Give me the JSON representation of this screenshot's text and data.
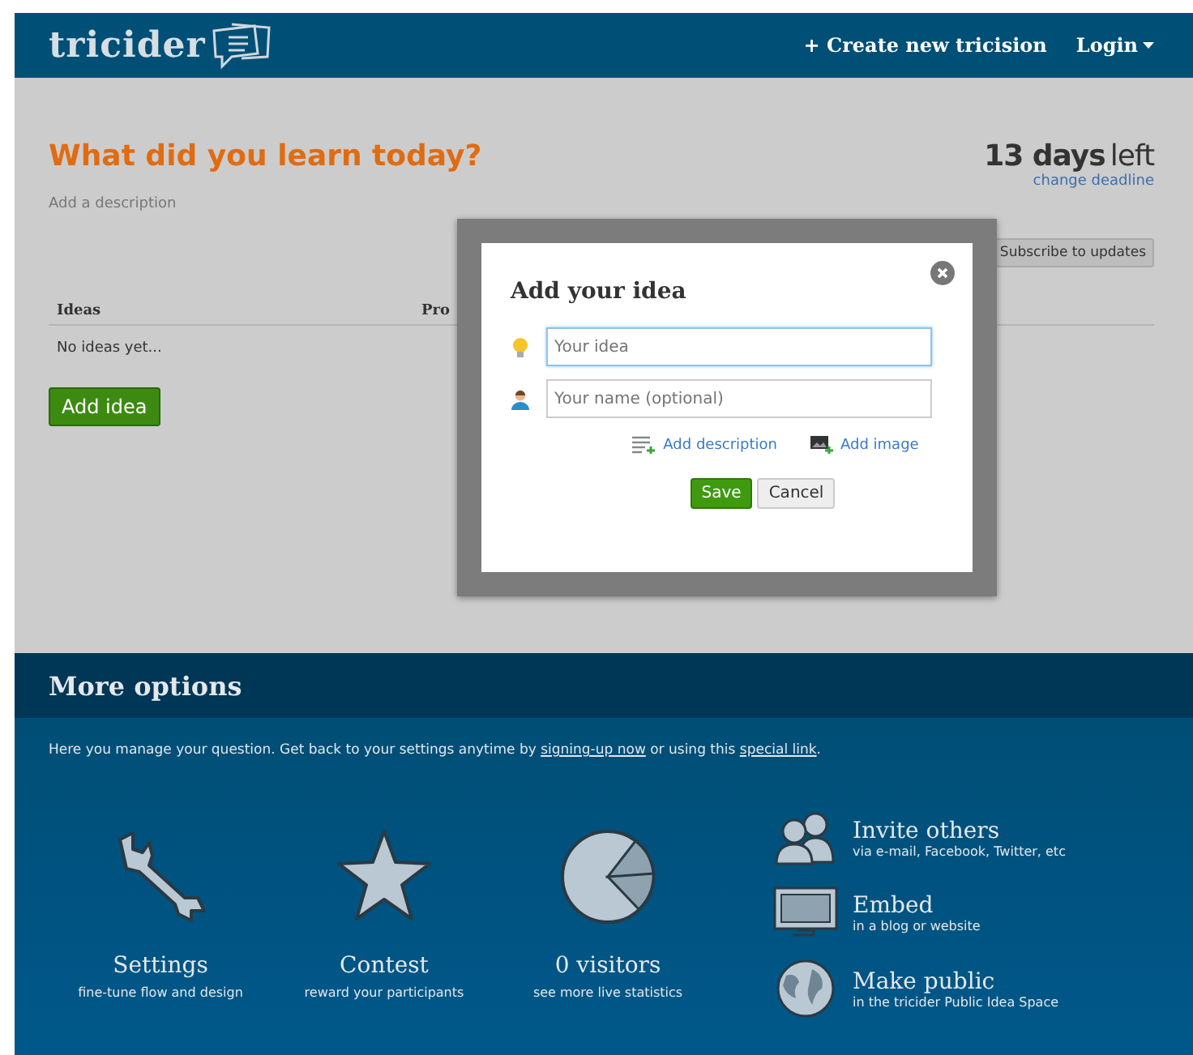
{
  "header": {
    "logo": "tricider",
    "nav": [
      {
        "label": "+ Create new tricision",
        "caret": false
      },
      {
        "label": "Login",
        "caret": true
      }
    ]
  },
  "question": {
    "title": "What did you learn today?",
    "description_link": "Add a description",
    "countdown_number": "13 days",
    "countdown_suffix": "left",
    "deadline_link": "change deadline",
    "subscribe_button": "Subscribe to updates"
  },
  "table": {
    "columns": [
      "Ideas",
      "Pro"
    ],
    "empty_text": "No ideas yet...",
    "add_button": "Add idea"
  },
  "dialog": {
    "title": "Add your idea",
    "fields": [
      {
        "kind": "idea",
        "placeholder": "Your idea",
        "focused": true
      },
      {
        "kind": "name",
        "placeholder": "Your name (optional)",
        "focused": false
      }
    ],
    "links": [
      {
        "kind": "description",
        "label": "Add description"
      },
      {
        "kind": "image",
        "label": "Add image"
      }
    ],
    "buttons": [
      {
        "kind": "primary",
        "label": "Save"
      },
      {
        "kind": "secondary",
        "label": "Cancel"
      }
    ]
  },
  "more_options": {
    "title": "More options",
    "intro": [
      {
        "text": "Here you manage your question. Get back to your settings anytime by ",
        "link": false
      },
      {
        "text": "signing-up now",
        "link": true
      },
      {
        "text": " or using this ",
        "link": false
      },
      {
        "text": "special link",
        "link": true
      },
      {
        "text": ".",
        "link": false
      }
    ],
    "tiles": [
      {
        "kind": "wrench",
        "title": "Settings",
        "subtitle": "fine-tune flow and design"
      },
      {
        "kind": "star",
        "title": "Contest",
        "subtitle": "reward your participants"
      },
      {
        "kind": "pie",
        "title": "0 visitors",
        "subtitle": "see more live statistics"
      }
    ],
    "actions": [
      {
        "kind": "people",
        "title": "Invite others",
        "subtitle": "via e-mail, Facebook, Twitter, etc"
      },
      {
        "kind": "monitor",
        "title": "Embed",
        "subtitle": "in a blog or website"
      },
      {
        "kind": "globe",
        "title": "Make public",
        "subtitle": "in the tricider Public Idea Space"
      }
    ]
  }
}
